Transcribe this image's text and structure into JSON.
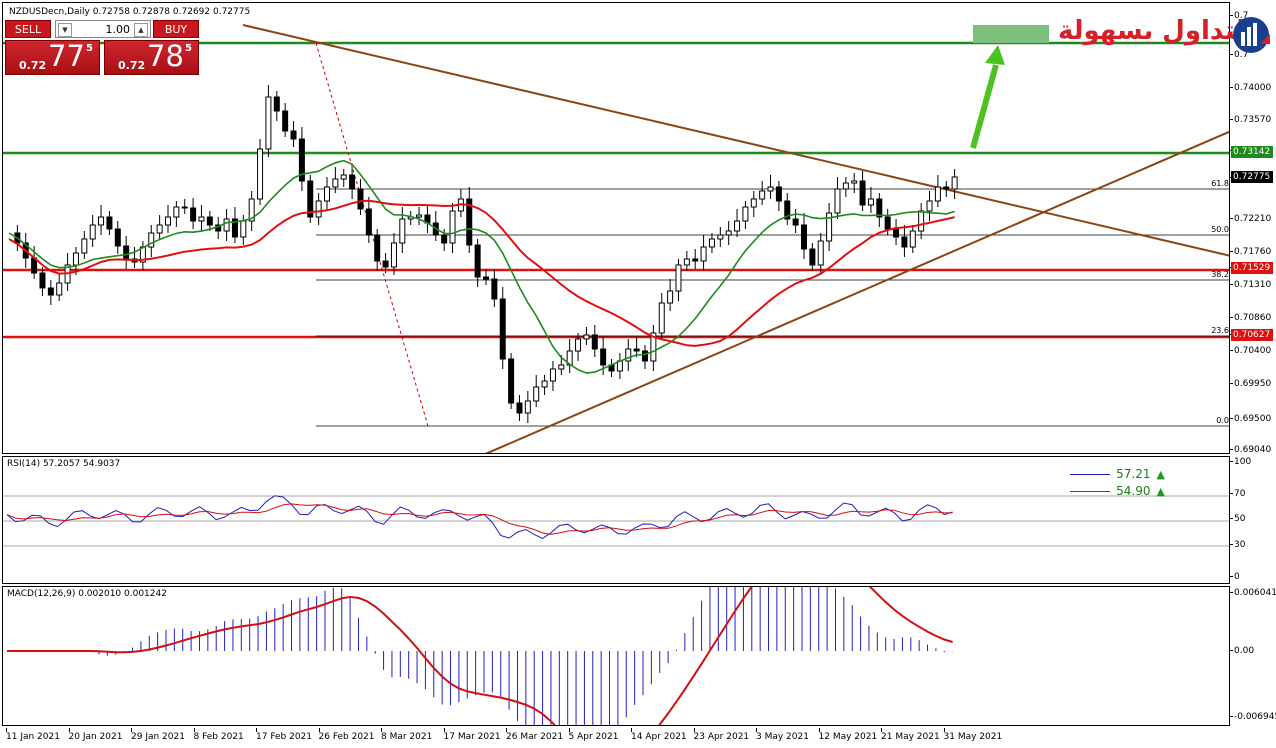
{
  "chart_title": "NZDUSDecn,Daily  0.72758 0.72878 0.72692 0.72775",
  "trade_panel": {
    "sell_label": "SELL",
    "buy_label": "BUY",
    "lot_value": "1.00",
    "lot_down_icon": "triangle-down",
    "lot_up_icon": "triangle-up",
    "sell_price": {
      "prefix": "0.72",
      "big": "77",
      "sup": "5"
    },
    "buy_price": {
      "prefix": "0.72",
      "big": "78",
      "sup": "5"
    }
  },
  "logo": {
    "text_red": "التداول بسهولة",
    "icon": "bar-chart-logo-icon"
  },
  "price_axis": [
    "0.74000",
    "0.73570",
    "0.73142",
    "0.72775",
    "0.72210",
    "0.71760",
    "0.71529",
    "0.71310",
    "0.70860",
    "0.70627",
    "0.70400",
    "0.69950",
    "0.69500",
    "0.69040"
  ],
  "price_axis_top_partial": [
    "0.7",
    "0.7"
  ],
  "level_labels": {
    "green_upper": "0.73142",
    "current": "0.72775",
    "red_upper": "0.71529",
    "red_lower": "0.70627"
  },
  "fib_labels": [
    "61.8",
    "50.0",
    "38.2",
    "23.6",
    "0.0"
  ],
  "rsi": {
    "title": "RSI(14) 57.2057 54.9037",
    "axis": [
      "100",
      "70",
      "50",
      "30",
      "0"
    ],
    "legend": [
      {
        "value": "57.21",
        "color": "#1f1fbf"
      },
      {
        "value": "54.90",
        "color": "#d01010"
      }
    ]
  },
  "macd": {
    "title": "MACD(12,26,9) 0.002010 0.001242",
    "axis": [
      "0.006041",
      "0.00",
      "-0.006945"
    ]
  },
  "time_axis": [
    "11 Jan 2021",
    "20 Jan 2021",
    "29 Jan 2021",
    "8 Feb 2021",
    "17 Feb 2021",
    "26 Feb 2021",
    "8 Mar 2021",
    "17 Mar 2021",
    "26 Mar 2021",
    "5 Apr 2021",
    "14 Apr 2021",
    "23 Apr 2021",
    "3 May 2021",
    "12 May 2021",
    "21 May 2021",
    "31 May 2021"
  ],
  "colors": {
    "green_level": "#1e8b1e",
    "red_level": "#e01010",
    "trendline": "#8b4513",
    "ma_fast": "#1e8b1e",
    "ma_slow": "#e01010",
    "arrow": "#4cc21e",
    "target_box": "#7cc07c"
  }
}
